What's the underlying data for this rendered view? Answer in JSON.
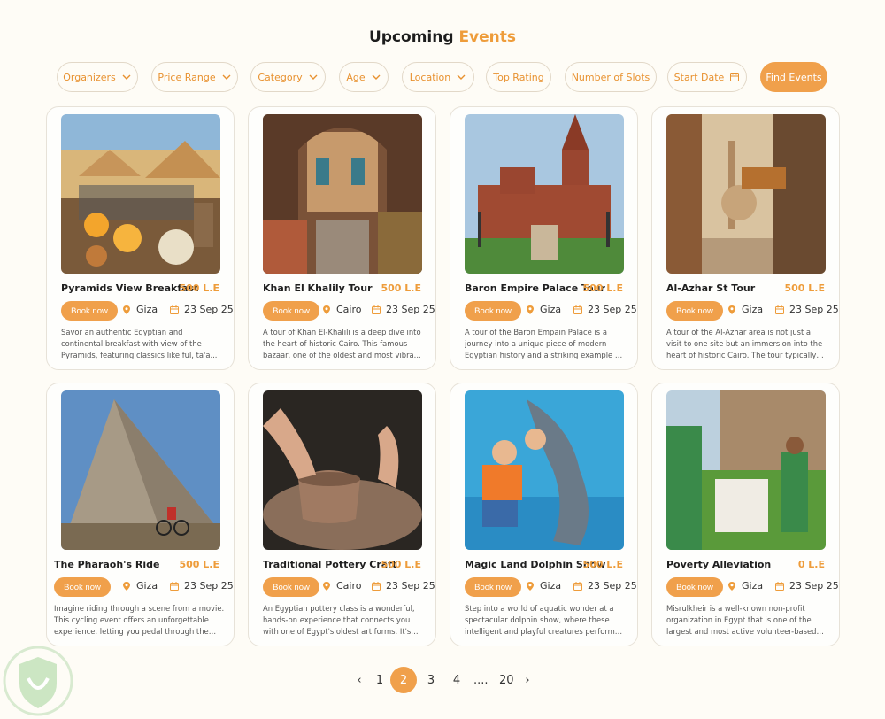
{
  "header": {
    "title_plain": "Upcoming",
    "title_accent": "Events"
  },
  "filters": [
    {
      "label": "Organizers",
      "icon": "chevron-down-icon"
    },
    {
      "label": "Price Range",
      "icon": "chevron-down-icon"
    },
    {
      "label": "Category",
      "icon": "chevron-down-icon"
    },
    {
      "label": "Age",
      "icon": "chevron-down-icon"
    },
    {
      "label": "Location",
      "icon": "chevron-down-icon"
    },
    {
      "label": "Top Rating",
      "icon": ""
    },
    {
      "label": "Number of Slots",
      "icon": ""
    },
    {
      "label": "Start Date",
      "icon": "calendar-icon"
    },
    {
      "label": "Find Events",
      "icon": ""
    }
  ],
  "events": [
    {
      "name": "Pyramids View Breakfast",
      "price": "500 L.E",
      "book": "Book now",
      "location": "Giza",
      "date": "23 Sep 25",
      "description": "Savor an authentic Egyptian and continental breakfast with view of the Pyramids, featuring classics like ful, ta'a..."
    },
    {
      "name": "Khan El Khalily Tour",
      "price": "500 L.E",
      "book": "Book now",
      "location": "Cairo",
      "date": "23 Sep 25",
      "description": "A tour of Khan El-Khalili is a deep dive into the heart of historic Cairo. This famous bazaar, one of the oldest and most vibra..."
    },
    {
      "name": "Baron Empire Palace Tour",
      "price": "500 L.E",
      "book": "Book now",
      "location": "Giza",
      "date": "23 Sep 25",
      "description": "A tour of the Baron Empain Palace is a journey into a unique piece of modern Egyptian history and a striking example of architectur..."
    },
    {
      "name": "Al-Azhar St Tour",
      "price": "500 L.E",
      "book": "Book now",
      "location": "Giza",
      "date": "23 Sep 25",
      "description": "A tour of the Al-Azhar area is not just a visit to one site but an immersion into the heart of historic Cairo. The tour typically centers arou..."
    },
    {
      "name": "The Pharaoh's Ride",
      "price": "500 L.E",
      "book": "Book now",
      "location": "Giza",
      "date": "23 Sep 25",
      "description": "Imagine riding through a scene from a movie. This cycling event offers an unforgettable experience, letting you pedal through the vas..."
    },
    {
      "name": "Traditional Pottery Craft",
      "price": "500 L.E",
      "book": "Book now",
      "location": "Cairo",
      "date": "23 Sep 25",
      "description": "An Egyptian pottery class is a wonderful, hands-on experience that connects you with one of Egypt's oldest art forms. It's a..."
    },
    {
      "name": "Magic Land Dolphin Show",
      "price": "500 L.E",
      "book": "Book now",
      "location": "Giza",
      "date": "23 Sep 25",
      "description": "Step into a world of aquatic wonder at a spectacular dolphin show, where these intelligent and playful creatures perform incr..."
    },
    {
      "name": "Poverty Alleviation",
      "price": "0 L.E",
      "book": "Book now",
      "location": "Giza",
      "date": "23 Sep 25",
      "description": "Misrulkheir is a well-known non-profit organization in Egypt that is one of the largest and most active volunteer-based entities in t..."
    }
  ],
  "pagination": {
    "prev": "‹",
    "pages": [
      "1",
      "2",
      "3",
      "4",
      "....",
      "20"
    ],
    "current": "2",
    "next": "›"
  },
  "colors": {
    "accent": "#f0a04b",
    "accent_text": "#ee9c3a",
    "background": "#fefcf6"
  }
}
